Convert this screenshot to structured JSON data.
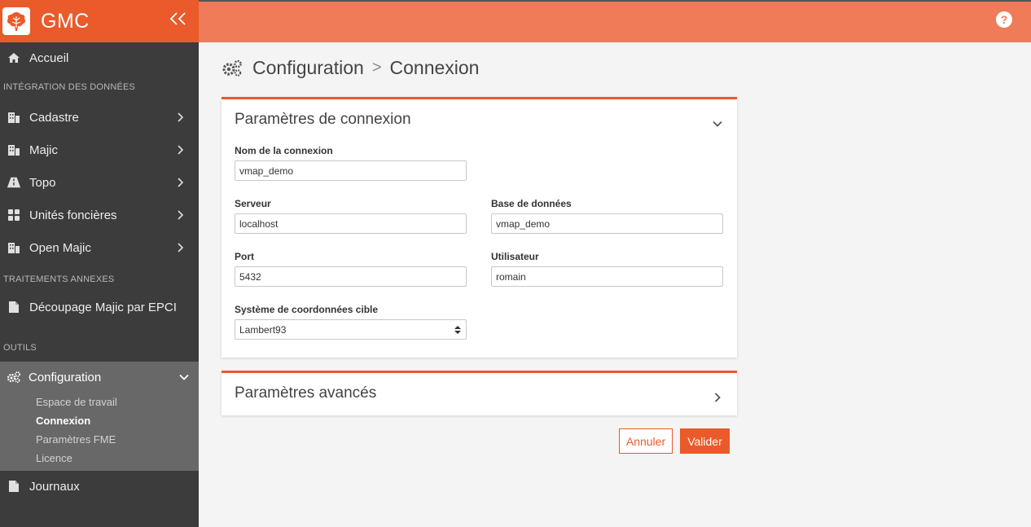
{
  "brand": {
    "name": "GMC",
    "collapse_icon": "double-chevron-left-icon"
  },
  "sidebar": {
    "home": {
      "label": "Accueil",
      "icon": "home-icon"
    },
    "section_integration": "INTÉGRATION DES DONNÉES",
    "items": [
      {
        "label": "Cadastre",
        "icon": "building-icon"
      },
      {
        "label": "Majic",
        "icon": "building-icon"
      },
      {
        "label": "Topo",
        "icon": "road-icon"
      },
      {
        "label": "Unités foncières",
        "icon": "grid-icon"
      },
      {
        "label": "Open Majic",
        "icon": "building-icon"
      }
    ],
    "section_treatments": "TRAITEMENTS ANNEXES",
    "decoupage": {
      "label": "Découpage Majic par EPCI",
      "icon": "file-icon"
    },
    "section_tools": "OUTILS",
    "configuration": {
      "label": "Configuration",
      "icon": "gears-icon",
      "subitems": [
        "Espace de travail",
        "Connexion",
        "Paramètres FME",
        "Licence"
      ],
      "current": "Connexion"
    },
    "journaux": {
      "label": "Journaux",
      "icon": "file-icon"
    }
  },
  "topbar": {
    "help_label": "?"
  },
  "page": {
    "crumb_parent": "Configuration",
    "crumb_sep": ">",
    "crumb_current": "Connexion"
  },
  "connection_panel": {
    "title": "Paramètres de connexion",
    "fields": {
      "name": {
        "label": "Nom de la connexion",
        "value": "vmap_demo"
      },
      "server": {
        "label": "Serveur",
        "value": "localhost"
      },
      "database": {
        "label": "Base de données",
        "value": "vmap_demo"
      },
      "port": {
        "label": "Port",
        "value": "5432"
      },
      "user": {
        "label": "Utilisateur",
        "value": "romain"
      },
      "crs": {
        "label": "Système de coordonnées cible",
        "value": "Lambert93"
      }
    }
  },
  "advanced_panel": {
    "title": "Paramètres avancés"
  },
  "actions": {
    "cancel_label": "Annuler",
    "submit_label": "Valider"
  },
  "colors": {
    "accent": "#ea5a2a",
    "topbar": "#f07b58",
    "sidebar": "#3c3c3c"
  }
}
